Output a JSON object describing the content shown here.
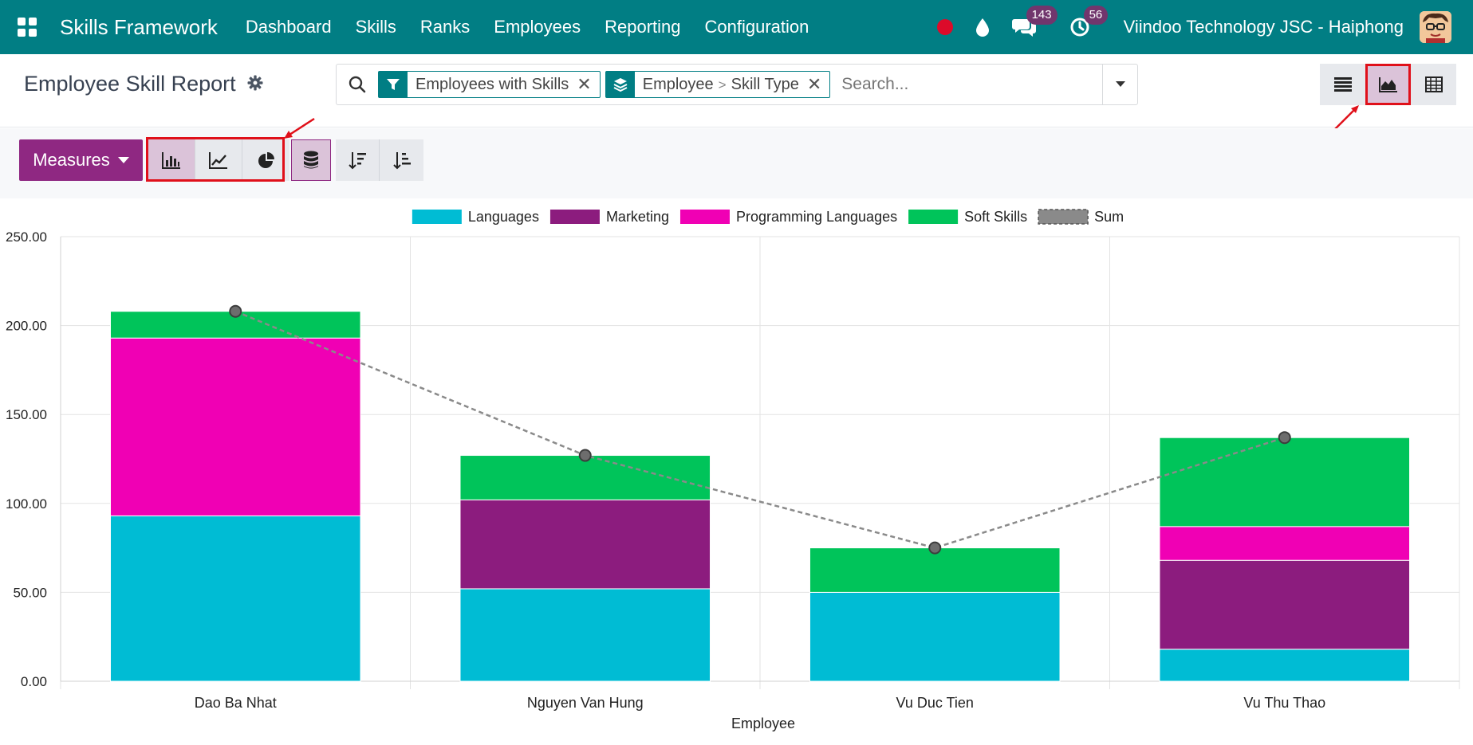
{
  "app": {
    "brand": "Skills Framework",
    "menu": [
      "Dashboard",
      "Skills",
      "Ranks",
      "Employees",
      "Reporting",
      "Configuration"
    ],
    "messages_count": "143",
    "activities_count": "56",
    "company": "Viindoo Technology JSC - Haiphong"
  },
  "control": {
    "title": "Employee Skill Report",
    "filter_facet": "Employees with Skills",
    "groupby_facet": [
      "Employee",
      "Skill Type"
    ],
    "groupby_separator": ">",
    "search_placeholder": "Search...",
    "active_view": "graph"
  },
  "toolbar": {
    "measures_label": "Measures",
    "active_chart_type": "bar",
    "stacked": true
  },
  "colors": {
    "navbar": "#017e84",
    "primary": "#8f2882",
    "highlight": "#e0101a"
  },
  "chart_data": {
    "type": "bar",
    "stacked": true,
    "xlabel": "Employee",
    "categories": [
      "Dao Ba Nhat",
      "Nguyen Van Hung",
      "Vu Duc Tien",
      "Vu Thu Thao"
    ],
    "ylim": [
      0,
      250
    ],
    "yticks": [
      "0.00",
      "50.00",
      "100.00",
      "150.00",
      "200.00",
      "250.00"
    ],
    "grid": true,
    "legend_position": "top-center",
    "series": [
      {
        "name": "Languages",
        "color": "#00bcd4",
        "values": [
          93,
          52,
          50,
          18
        ]
      },
      {
        "name": "Marketing",
        "color": "#8c1c7e",
        "values": [
          0,
          50,
          0,
          50
        ]
      },
      {
        "name": "Programming Languages",
        "color": "#f000b4",
        "values": [
          100,
          0,
          0,
          19
        ]
      },
      {
        "name": "Soft Skills",
        "color": "#00c45a",
        "values": [
          15,
          25,
          25,
          50
        ]
      }
    ],
    "sum": {
      "name": "Sum",
      "color": "#8a8a8a",
      "values": [
        208,
        127,
        75,
        137
      ]
    }
  }
}
